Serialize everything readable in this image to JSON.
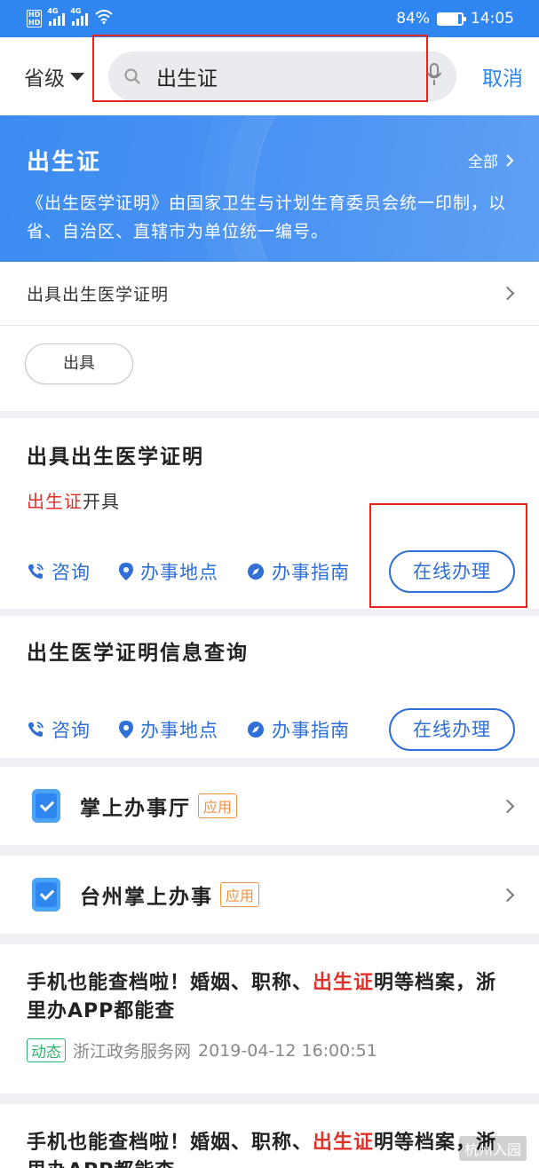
{
  "status_bar": {
    "battery": "84%",
    "time": "14:05",
    "battery_level": 0.84
  },
  "search": {
    "province": "省级",
    "query": "出生证",
    "cancel": "取消"
  },
  "banner": {
    "title": "出生证",
    "all": "全部",
    "description": "《出生医学证明》由国家卫生与计划生育委员会统一印制，以省、自治区、直辖市为单位统一编号。"
  },
  "category": {
    "label": "出具出生医学证明"
  },
  "tags": [
    "出具"
  ],
  "services": [
    {
      "title": "出具出生医学证明",
      "subtitle_highlight": "出生证",
      "subtitle_rest": "开具",
      "actions": {
        "consult": "咨询",
        "location": "办事地点",
        "guide": "办事指南",
        "online": "在线办理"
      }
    },
    {
      "title": "出生医学证明信息查询",
      "actions": {
        "consult": "咨询",
        "location": "办事地点",
        "guide": "办事指南",
        "online": "在线办理"
      }
    }
  ],
  "apps": [
    {
      "name": "掌上办事厅",
      "badge": "应用"
    },
    {
      "name": "台州掌上办事",
      "badge": "应用"
    }
  ],
  "news": [
    {
      "title_before": "手机也能查档啦！婚姻、职称、",
      "title_highlight": "出生证",
      "title_after": "明等档案，浙里办APP都能查",
      "tag": "动态",
      "source": "浙江政务服务网",
      "time": "2019-04-12 16:00:51"
    },
    {
      "title_before": "手机也能查档啦！婚姻、职称、",
      "title_highlight": "出生证",
      "title_after": "明等档案，浙里办APP都能查"
    }
  ],
  "watermark": "杭州入园",
  "colors": {
    "primary": "#2f86f0",
    "highlight": "#e0302a",
    "annotation": "#e8231d",
    "badge": "#f09140",
    "news_tag": "#2fb36e"
  }
}
